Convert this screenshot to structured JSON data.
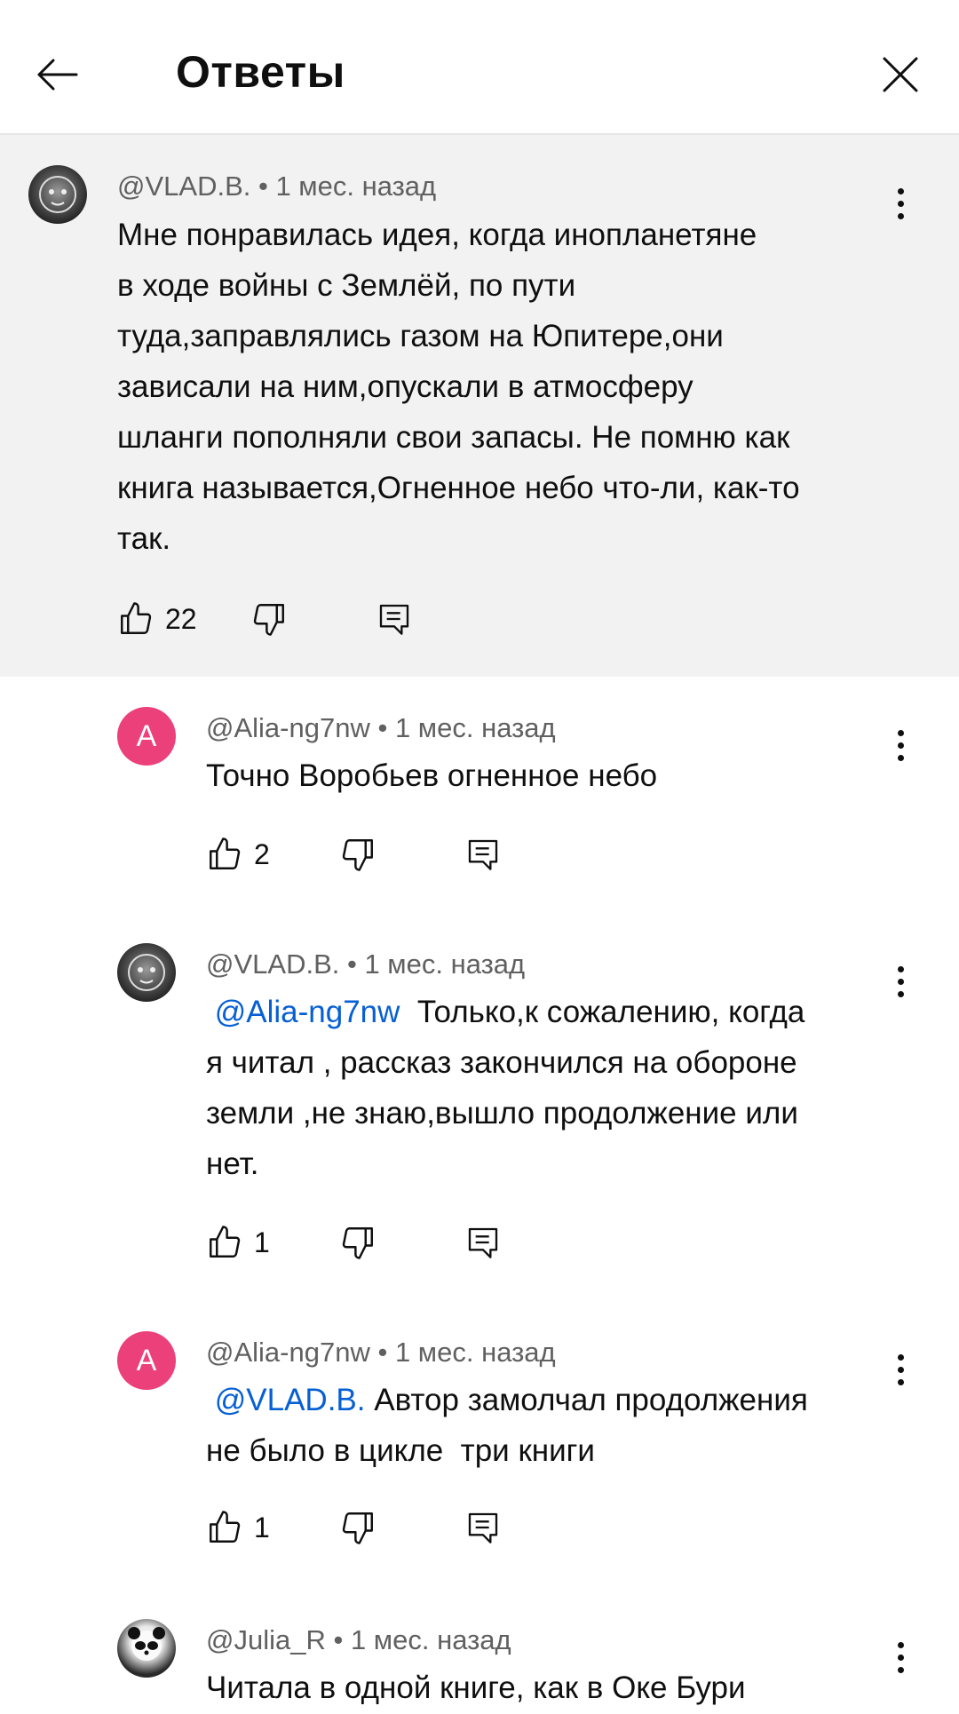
{
  "header": {
    "title": "Ответы",
    "back_icon": "arrow-back-icon",
    "close_icon": "close-icon"
  },
  "parent_comment": {
    "author": "@VLAD.B.",
    "time": "1 мес. назад",
    "text_lines": [
      "Мне понравилась идея, когда инопланетяне",
      "в ходе войны с Землёй, по пути",
      "туда,заправлялись газом на Юпитере,они",
      "зависали на ним,опускали в атмосферу",
      "шланги пополняли свои запасы. Не помню как",
      "книга называется,Огненное небо что-ли, как-то",
      "так."
    ],
    "likes": "22"
  },
  "replies": [
    {
      "author": "@Alia-ng7nw",
      "time": "1 мес. назад",
      "avatar_letter": "A",
      "mention": "",
      "text_lines": [
        "Точно Воробьев огненное небо"
      ],
      "likes": "2"
    },
    {
      "author": "@VLAD.B.",
      "time": "1 мес. назад",
      "avatar_letter": "",
      "mention": "@Alia-ng7nw",
      "first_line_rest": "Только,к сожалению, когда",
      "text_lines": [
        "я читал , рассказ закончился на обороне",
        "земли ,не знаю,вышло продолжение или",
        "нет."
      ],
      "likes": "1"
    },
    {
      "author": "@Alia-ng7nw",
      "time": "1 мес. назад",
      "avatar_letter": "A",
      "mention": "@VLAD.B.",
      "first_line_rest": "Автор замолчал продолжения",
      "text_lines": [
        "не было в цикле  три книги"
      ],
      "likes": "1"
    },
    {
      "author": "@Julia_R",
      "time": "1 мес. назад",
      "avatar_letter": "",
      "mention": "",
      "text_lines": [
        "Читала в одной книге, как в Оке Бури"
      ],
      "likes": ""
    }
  ],
  "separator": " • ",
  "icons": {
    "like": "thumb-up-icon",
    "dislike": "thumb-down-icon",
    "reply": "reply-comment-icon",
    "more": "more-vert-icon"
  }
}
